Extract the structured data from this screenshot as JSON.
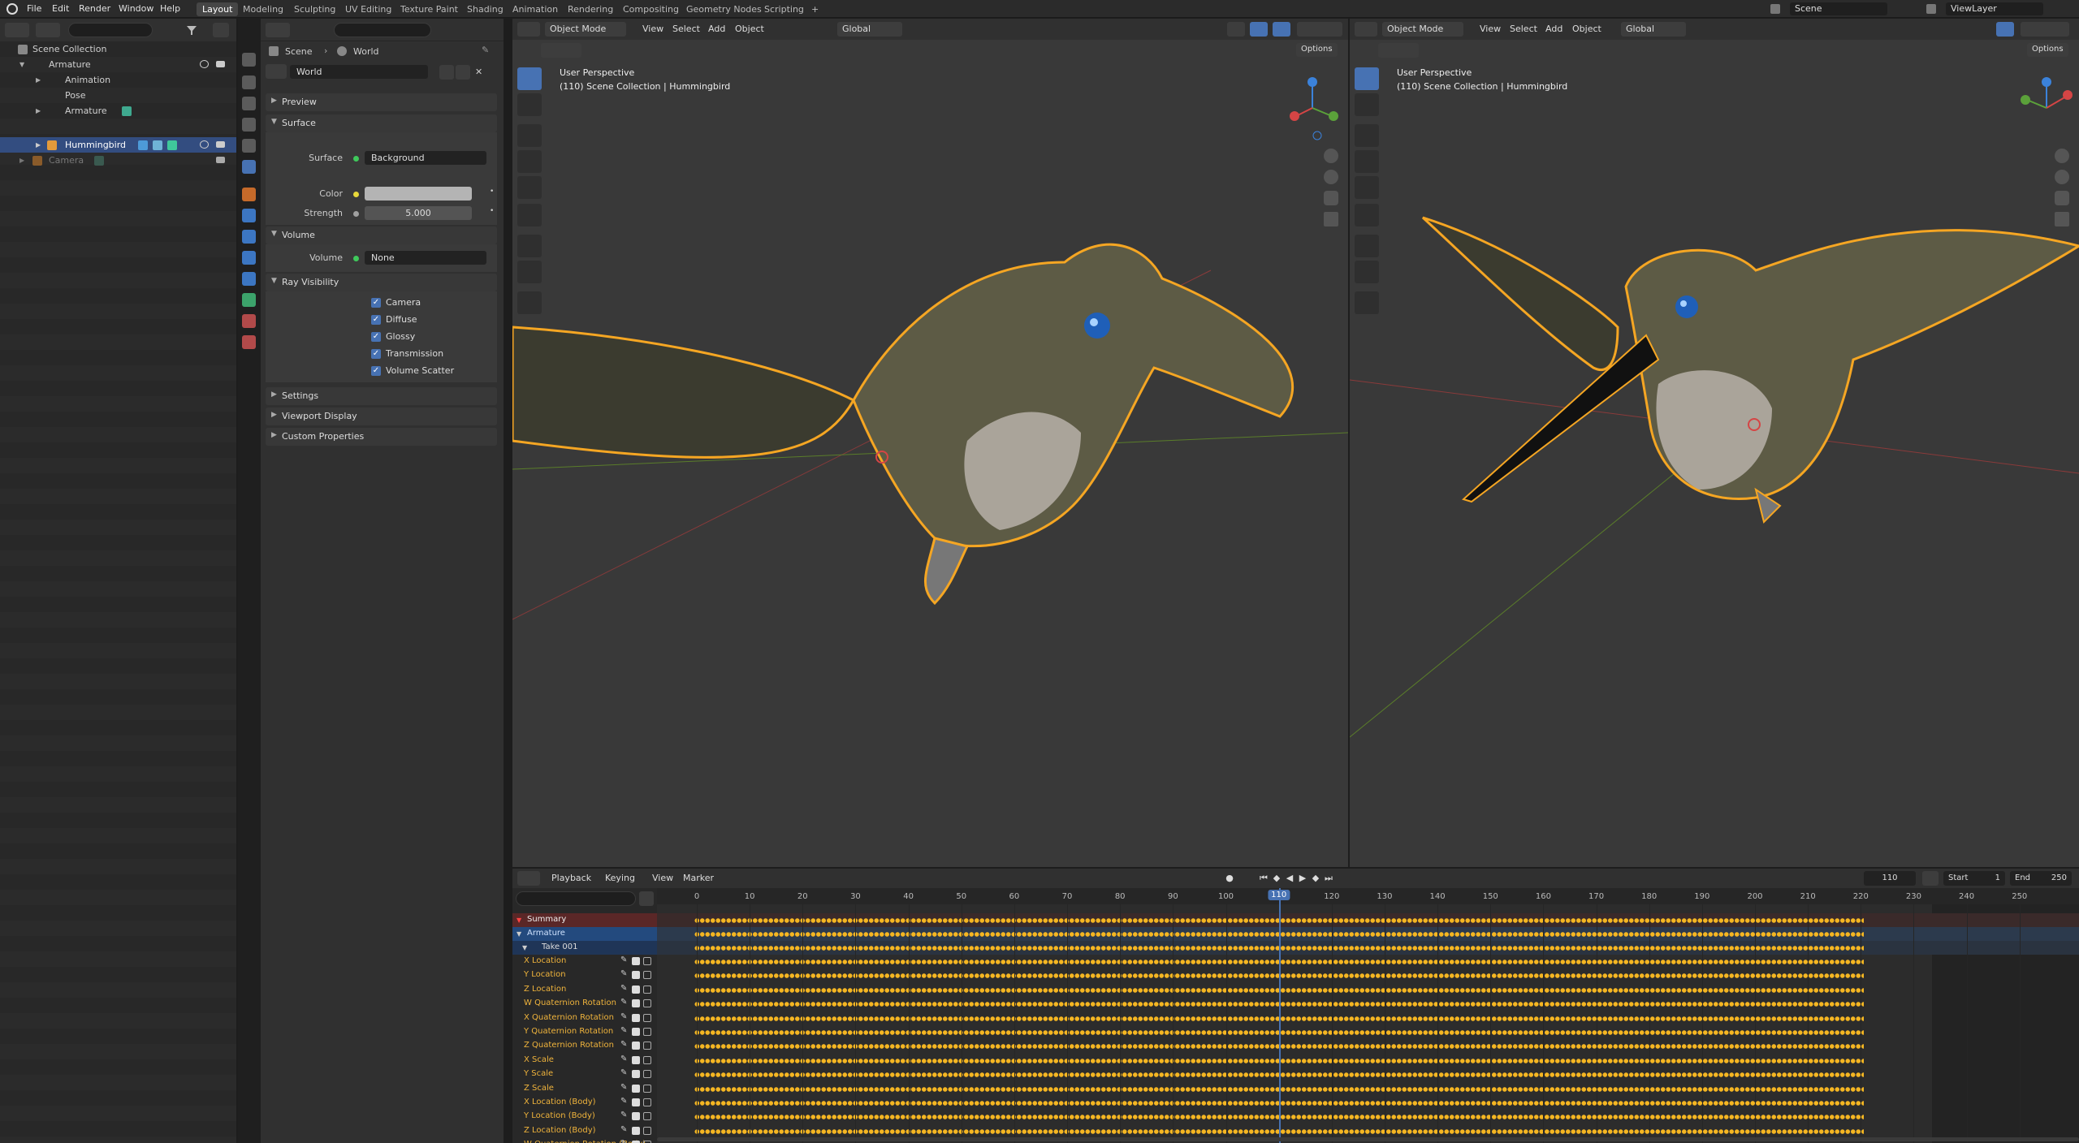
{
  "topbar": {
    "menus": [
      "File",
      "Edit",
      "Render",
      "Window",
      "Help"
    ],
    "workspaces": [
      "Layout",
      "Modeling",
      "Sculpting",
      "UV Editing",
      "Texture Paint",
      "Shading",
      "Animation",
      "Rendering",
      "Compositing",
      "Geometry Nodes",
      "Scripting"
    ],
    "add_workspace": "+",
    "scene": "Scene",
    "view_layer": "ViewLayer"
  },
  "outliner": {
    "items": [
      {
        "label": "Scene Collection"
      },
      {
        "label": "Armature"
      },
      {
        "label": "Animation"
      },
      {
        "label": "Pose"
      },
      {
        "label": "Armature"
      },
      {
        "label": "Hummingbird"
      },
      {
        "label": "Camera"
      }
    ]
  },
  "properties": {
    "breadcrumb": {
      "scene": "Scene",
      "sep": "›",
      "world": "World"
    },
    "world_name": "World",
    "panels": {
      "preview": "Preview",
      "surface": "Surface",
      "volume": "Volume",
      "ray_visibility": "Ray Visibility",
      "settings": "Settings",
      "viewport_display": "Viewport Display",
      "custom_properties": "Custom Properties"
    },
    "surface_label": "Surface",
    "surface_value": "Background",
    "color_label": "Color",
    "strength_label": "Strength",
    "strength_value": "5.000",
    "volume_label": "Volume",
    "volume_value": "None",
    "ray_items": [
      "Camera",
      "Diffuse",
      "Glossy",
      "Transmission",
      "Volume Scatter"
    ]
  },
  "viewport": {
    "mode": "Object Mode",
    "menus": [
      "View",
      "Select",
      "Add",
      "Object"
    ],
    "orientation": "Global",
    "options": "Options",
    "perspective": "User Perspective",
    "collection_info": "(110) Scene Collection | Hummingbird"
  },
  "dopesheet": {
    "menus": [
      "Playback",
      "Keying",
      "View",
      "Marker"
    ],
    "current_frame": "110",
    "start_label": "Start",
    "start_value": "1",
    "end_label": "End",
    "end_value": "250",
    "frame_ticks": [
      "0",
      "10",
      "20",
      "30",
      "40",
      "50",
      "60",
      "70",
      "80",
      "90",
      "100",
      "110",
      "120",
      "130",
      "140",
      "150",
      "160",
      "170",
      "180",
      "190",
      "200",
      "210",
      "220",
      "230",
      "240",
      "250"
    ],
    "summary": "Summary",
    "object": "Armature",
    "action": "Take 001",
    "channels": [
      "X Location",
      "Y Location",
      "Z Location",
      "W Quaternion Rotation",
      "X Quaternion Rotation",
      "Y Quaternion Rotation",
      "Z Quaternion Rotation",
      "X Scale",
      "Y Scale",
      "Z Scale",
      "X Location (Body)",
      "Y Location (Body)",
      "Z Location (Body)",
      "W Quaternion Rotation (Body)"
    ]
  },
  "colors": {
    "accent": "#4772b3",
    "selection": "#334d80",
    "keyframe": "#f5b622",
    "outline": "#f5a623",
    "summary_row": "#5a2727",
    "channel_text": "#f0b43c"
  },
  "icons": {
    "playhead": "blue-frame-marker",
    "checkbox": "checkmark-icon"
  }
}
